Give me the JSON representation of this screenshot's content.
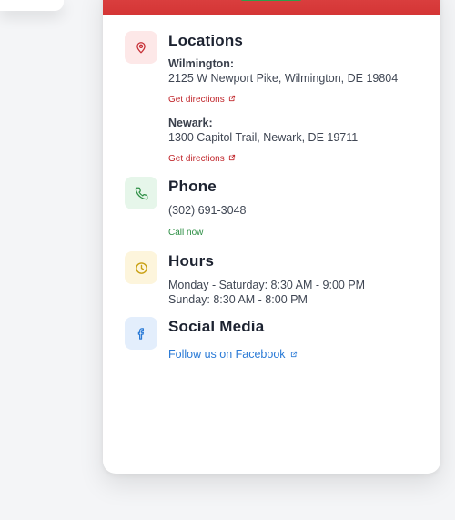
{
  "header": {
    "accent_color": "#d43535",
    "button_color": "#2e9e4a"
  },
  "locations": {
    "title": "Locations",
    "icon": "map-pin-icon",
    "items": [
      {
        "name": "Wilmington:",
        "address": "2125 W Newport Pike, Wilmington, DE 19804",
        "link": "Get directions"
      },
      {
        "name": "Newark:",
        "address": "1300 Capitol Trail, Newark, DE 19711",
        "link": "Get directions"
      }
    ]
  },
  "phone": {
    "title": "Phone",
    "icon": "phone-icon",
    "number": "(302) 691-3048",
    "link": "Call now"
  },
  "hours": {
    "title": "Hours",
    "icon": "clock-icon",
    "lines": [
      "Monday - Saturday: 8:30 AM - 9:00 PM",
      "Sunday: 8:30 AM - 8:00 PM"
    ]
  },
  "social": {
    "title": "Social Media",
    "icon": "facebook-icon",
    "link": "Follow us on Facebook"
  }
}
